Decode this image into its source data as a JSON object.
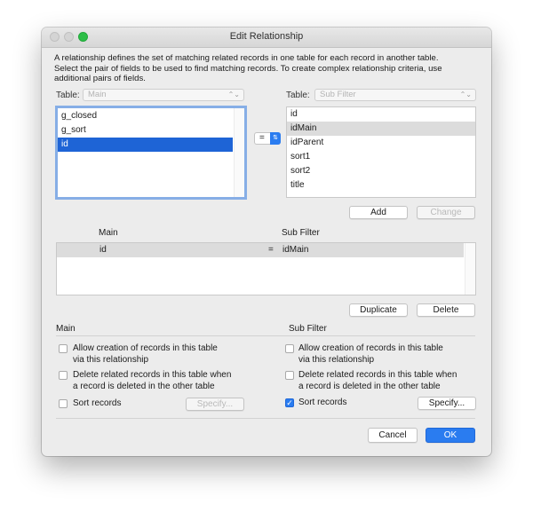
{
  "window": {
    "title": "Edit Relationship"
  },
  "description": {
    "line1": "A relationship defines the set of matching related records in one table for each record in another table.",
    "line2": "Select the pair of fields to be used to find matching records. To create complex relationship criteria, use",
    "line3": "additional pairs of fields."
  },
  "left_table": {
    "label": "Table:",
    "value": "Main",
    "fields": [
      "g_closed",
      "g_sort",
      "id"
    ],
    "selected": "id"
  },
  "operator": {
    "value": "="
  },
  "right_table": {
    "label": "Table:",
    "value": "Sub Filter",
    "fields": [
      "id",
      "idMain",
      "idParent",
      "sort1",
      "sort2",
      "title"
    ],
    "selected": "idMain"
  },
  "buttons": {
    "add": "Add",
    "change": "Change",
    "duplicate": "Duplicate",
    "delete": "Delete",
    "specify_left": "Specify...",
    "specify_right": "Specify...",
    "cancel": "Cancel",
    "ok": "OK"
  },
  "criteria": {
    "headers": {
      "left": "Main",
      "right": "Sub Filter"
    },
    "rows": [
      {
        "left": "id",
        "op": "=",
        "right": "idMain"
      }
    ]
  },
  "options": {
    "left": {
      "heading": "Main",
      "allow_line1": "Allow creation of records in this table",
      "allow_line2": "via this relationship",
      "allow_checked": false,
      "delete_line1": "Delete related records in this table when",
      "delete_line2": "a record is deleted in the other table",
      "delete_checked": false,
      "sort_label": "Sort records",
      "sort_checked": false
    },
    "right": {
      "heading": "Sub Filter",
      "allow_line1": "Allow creation of records in this table",
      "allow_line2": "via this relationship",
      "allow_checked": false,
      "delete_line1": "Delete related records in this table when",
      "delete_line2": "a record is deleted in the other table",
      "delete_checked": false,
      "sort_label": "Sort records",
      "sort_checked": true
    }
  },
  "icons": {
    "check": "✓",
    "popup_arrows": "⌃⌄",
    "stepper": "⇅"
  },
  "colors": {
    "accent": "#2a7cf0",
    "selection_active": "#1e64d6",
    "selection_inactive": "#dcdcdc",
    "close": "#d0d0d0",
    "minimize": "#d0d0d0",
    "zoom": "#2dbe47"
  }
}
